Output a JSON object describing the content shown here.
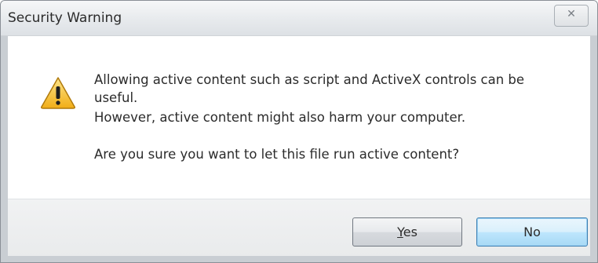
{
  "window": {
    "title": "Security Warning",
    "close_glyph": "✕"
  },
  "message": {
    "line1": "Allowing active content such as script and ActiveX controls can be",
    "line2": "useful.",
    "line3": "However, active content might also harm your computer.",
    "question": "Are you sure you want to let this file run active content?"
  },
  "icon": {
    "name": "warning-icon",
    "color": "#f5c02c",
    "mark": "!"
  },
  "buttons": {
    "yes_accel": "Y",
    "yes_rest": "es",
    "no_label": "No"
  }
}
